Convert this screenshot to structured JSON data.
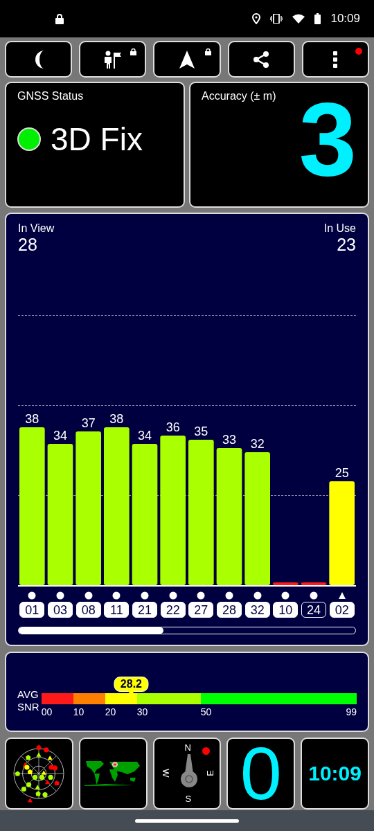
{
  "status_bar": {
    "time": "10:09"
  },
  "toolbar": [
    {
      "kind": "moon",
      "locked": false,
      "badge": false
    },
    {
      "kind": "person_flag",
      "locked": true,
      "badge": false
    },
    {
      "kind": "arrow",
      "locked": true,
      "badge": false
    },
    {
      "kind": "share",
      "locked": false,
      "badge": false
    },
    {
      "kind": "more",
      "locked": false,
      "badge": true
    }
  ],
  "gnss_status": {
    "title": "GNSS Status",
    "value": "3D Fix"
  },
  "accuracy": {
    "title": "Accuracy (± m)",
    "value": "3"
  },
  "satellites": {
    "in_view_label": "In View",
    "in_view": "28",
    "in_use_label": "In Use",
    "in_use": "23",
    "chart_data": {
      "type": "bar",
      "categories": [
        "01",
        "03",
        "08",
        "11",
        "21",
        "22",
        "27",
        "28",
        "32",
        "10",
        "24",
        "02"
      ],
      "values": [
        38,
        34,
        37,
        38,
        34,
        36,
        35,
        33,
        32,
        0,
        0,
        25
      ],
      "value_labels": [
        "38",
        "34",
        "37",
        "38",
        "34",
        "36",
        "35",
        "33",
        "32",
        null,
        null,
        "25"
      ]
    },
    "markers": [
      {
        "kind": "circle",
        "highlighted": false
      },
      {
        "kind": "circle",
        "highlighted": false
      },
      {
        "kind": "circle",
        "highlighted": false
      },
      {
        "kind": "circle",
        "highlighted": false
      },
      {
        "kind": "circle",
        "highlighted": false
      },
      {
        "kind": "circle",
        "highlighted": false
      },
      {
        "kind": "circle",
        "highlighted": false
      },
      {
        "kind": "circle",
        "highlighted": false
      },
      {
        "kind": "circle",
        "highlighted": false
      },
      {
        "kind": "circle",
        "highlighted": false
      },
      {
        "kind": "circle",
        "highlighted": true
      },
      {
        "kind": "triangle",
        "highlighted": false
      }
    ]
  },
  "snr": {
    "label_top": "AVG",
    "label_bottom": "SNR",
    "value": "28.2",
    "level": 0.285,
    "ticks": [
      "00",
      "10",
      "20",
      "30",
      "50",
      "99"
    ]
  },
  "tiles": [
    {
      "kind": "sky_plot"
    },
    {
      "kind": "world_map"
    },
    {
      "kind": "compass",
      "north": "N",
      "west": "W",
      "east": "E",
      "south": "S"
    },
    {
      "kind": "number",
      "value": "0"
    },
    {
      "kind": "clock",
      "value": "10:09"
    }
  ]
}
